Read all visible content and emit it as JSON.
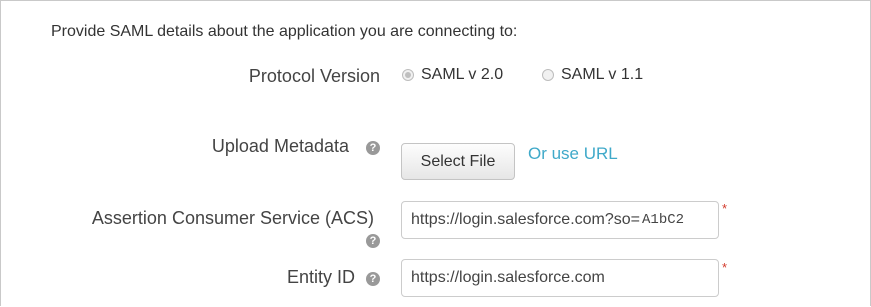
{
  "intro": "Provide SAML details about the application you are connecting to:",
  "protocol": {
    "label": "Protocol Version",
    "options": [
      {
        "label": "SAML v 2.0",
        "checked": true
      },
      {
        "label": "SAML v 1.1",
        "checked": false
      }
    ]
  },
  "metadata": {
    "label": "Upload Metadata",
    "button": "Select File",
    "alt_link": "Or use URL"
  },
  "acs": {
    "label": "Assertion Consumer Service (ACS)",
    "value_prefix": "https://login.salesforce.com?so=",
    "value_suffix": "A1bC2",
    "required_mark": "*"
  },
  "entity": {
    "label": "Entity ID",
    "value": "https://login.salesforce.com",
    "required_mark": "*"
  },
  "help_glyph": "?",
  "icons": {
    "help": "question-circle-icon"
  },
  "colors": {
    "link": "#3fa9c9",
    "required": "#d33a2c",
    "help_icon": "#999999"
  }
}
